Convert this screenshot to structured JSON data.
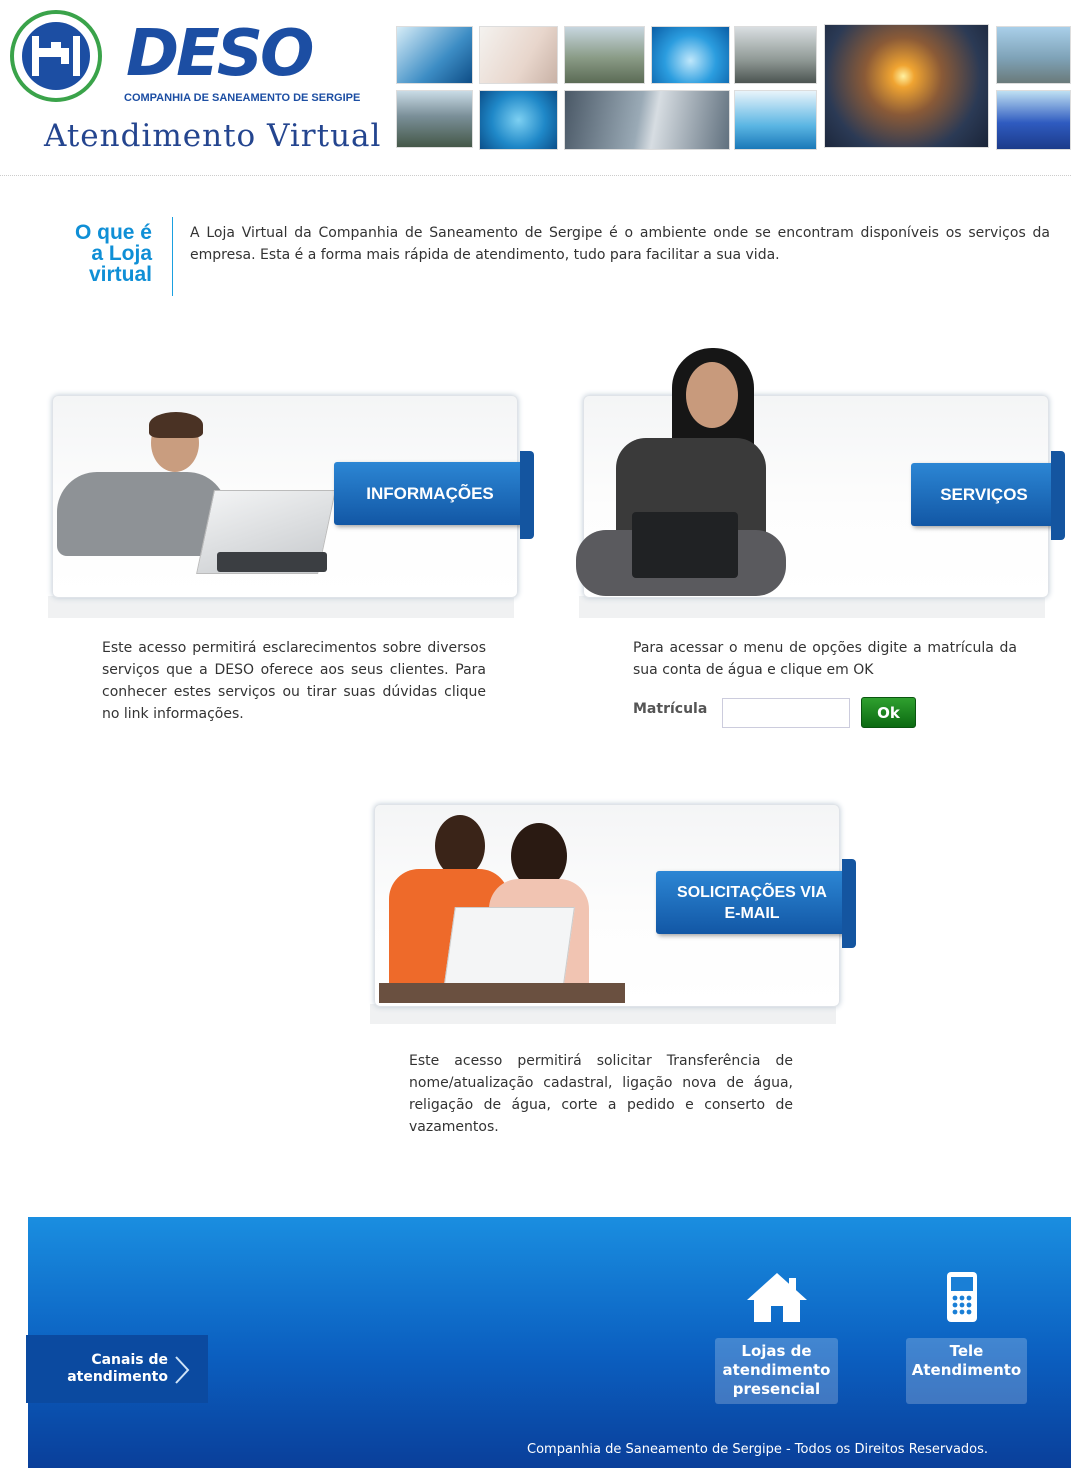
{
  "header": {
    "logo_text": "DESO",
    "company": "COMPANHIA DE SANEAMENTO DE SERGIPE",
    "subtitle": "Atendimento Virtual"
  },
  "intro": {
    "title_lines": [
      "O que é",
      "a Loja",
      "virtual"
    ],
    "text": "A Loja Virtual da Companhia de Saneamento de Sergipe é o ambiente onde se encontram disponíveis os serviços da empresa. Esta é a forma mais rápida de atendimento, tudo para facilitar a sua vida."
  },
  "cards": {
    "informacoes": {
      "label": "INFORMAÇÕES",
      "text": "Este acesso permitirá esclarecimentos sobre diversos serviços que a DESO oferece aos seus clientes. Para conhecer estes serviços ou tirar suas dúvidas clique no link informações."
    },
    "servicos": {
      "label": "SERVIÇOS",
      "text": "Para acessar o menu de opções digite a matrícula da sua conta de água e clique em OK"
    },
    "solicitacoes": {
      "label_lines": [
        "SOLICITAÇÕES VIA",
        "E-MAIL"
      ],
      "text": "Este acesso permitirá solicitar Transferência de nome/atualização cadastral, ligação nova de água, religação de água, corte a pedido e conserto de vazamentos."
    }
  },
  "form": {
    "matricula_label": "Matrícula",
    "matricula_value": "",
    "ok_label": "Ok"
  },
  "footer": {
    "canais_lines": [
      "Canais de",
      "atendimento"
    ],
    "lojas_lines": [
      "Lojas de",
      "atendimento",
      "presencial"
    ],
    "tele_lines": [
      "Tele",
      "Atendimento"
    ],
    "copyright": "Companhia de Saneamento de Sergipe - Todos os Direitos Reservados."
  },
  "colors": {
    "brand_blue": "#1c4ea3",
    "accent_green": "#3aa34a",
    "ok_green": "#1c8a22",
    "footer_blue": "#0b5fc0"
  },
  "icons": [
    "logo-tap-icon",
    "house-icon",
    "mobile-phone-icon",
    "chevron-right-icon"
  ]
}
